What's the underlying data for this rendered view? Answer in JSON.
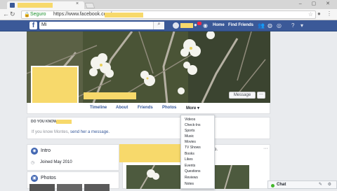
{
  "browser": {
    "security_label": "Seguro",
    "url": "https://www.facebook.com/",
    "close_glyph": "×"
  },
  "fb_header": {
    "search_value": "Mi",
    "home_label": "Home",
    "find_friends_label": "Find Friends"
  },
  "cover": {
    "message_button": "Message",
    "more_button": "···"
  },
  "profile_tabs": [
    {
      "label": "Timeline"
    },
    {
      "label": "About"
    },
    {
      "label": "Friends"
    },
    {
      "label": "Photos"
    },
    {
      "label": "More ▾"
    }
  ],
  "dyk": {
    "heading": "DO YOU KNOW",
    "text": "If you know Montes, ",
    "link": "send her a message."
  },
  "intro": {
    "title": "Intro",
    "joined": "Joined May 2010"
  },
  "photos": {
    "title": "Photos"
  },
  "post": {
    "header_fragment": "oto.",
    "menu": "···"
  },
  "more_menu": {
    "items": [
      "Videos",
      "Check-Ins",
      "Sports",
      "Music",
      "Movies",
      "TV Shows",
      "Books",
      "Likes",
      "Events",
      "Questions",
      "Reviews",
      "Notes"
    ]
  },
  "chat": {
    "label": "Chat"
  },
  "colors": {
    "fb_blue": "#3b5998",
    "link_blue": "#365899",
    "redaction_yellow": "#f7d96b"
  }
}
